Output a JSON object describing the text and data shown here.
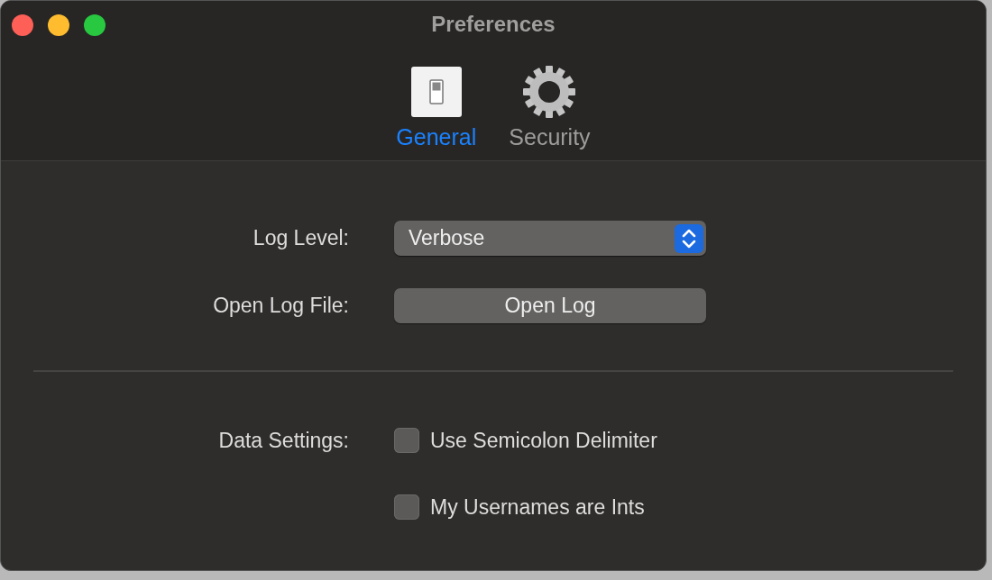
{
  "window": {
    "title": "Preferences"
  },
  "tabs": [
    {
      "label": "General",
      "selected": true,
      "kind": "switch"
    },
    {
      "label": "Security",
      "selected": false,
      "kind": "gear"
    }
  ],
  "settings": [
    {
      "label": "Log Level:",
      "kind": "select",
      "value": "Verbose"
    },
    {
      "label": "Open Log File:",
      "kind": "button",
      "text": "Open Log"
    }
  ],
  "data_settings": {
    "label": "Data Settings:",
    "options": [
      {
        "label": "Use Semicolon Delimiter",
        "checked": false
      },
      {
        "label": "My Usernames are Ints",
        "checked": false
      }
    ]
  }
}
